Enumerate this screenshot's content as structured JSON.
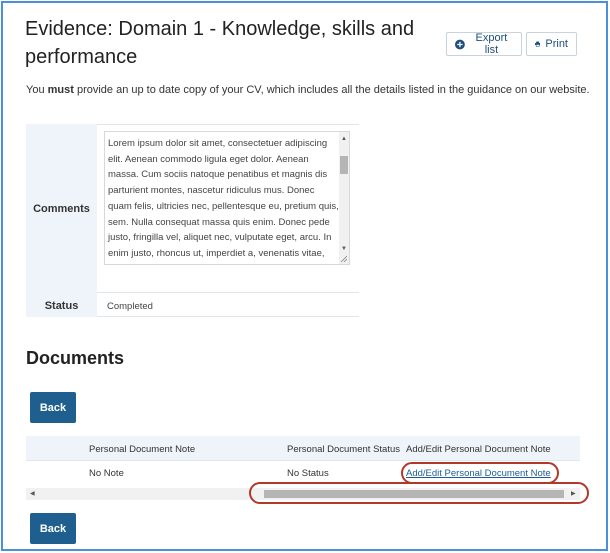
{
  "header": {
    "title": "Evidence: Domain 1 - Knowledge, skills and performance",
    "export_label": "Export list",
    "print_label": "Print"
  },
  "intro": {
    "before": "You ",
    "emphasis": "must",
    "after": " provide an up to date copy of your CV, which includes all the details listed in the guidance on our website."
  },
  "details": {
    "comments_label": "Comments",
    "comments_text": "Lorem ipsum dolor sit amet, consectetuer adipiscing elit. Aenean commodo ligula eget dolor. Aenean massa. Cum sociis natoque penatibus et magnis dis parturient montes, nascetur ridiculus mus. Donec quam felis, ultricies nec, pellentesque eu, pretium quis, sem. Nulla consequat massa quis enim. Donec pede justo, fringilla vel, aliquet nec, vulputate eget, arcu. In enim justo, rhoncus ut, imperdiet a, venenatis vitae, justo. Nullam dictum felis eu pede mollis pretium. Integer tincidunt.",
    "status_label": "Status",
    "status_value": "Completed"
  },
  "documents": {
    "title": "Documents",
    "back_label": "Back",
    "columns": [
      "Personal Document Note",
      "Personal Document Status",
      "Add/Edit Personal Document Note"
    ],
    "rows": [
      {
        "note": "No Note",
        "status": "No Status",
        "action": "Add/Edit Personal Document Note"
      }
    ]
  },
  "colors": {
    "accent": "#1f5f8f",
    "frame": "#4a90d9",
    "highlight": "#b2392a",
    "header_bg": "#eef4f9"
  }
}
